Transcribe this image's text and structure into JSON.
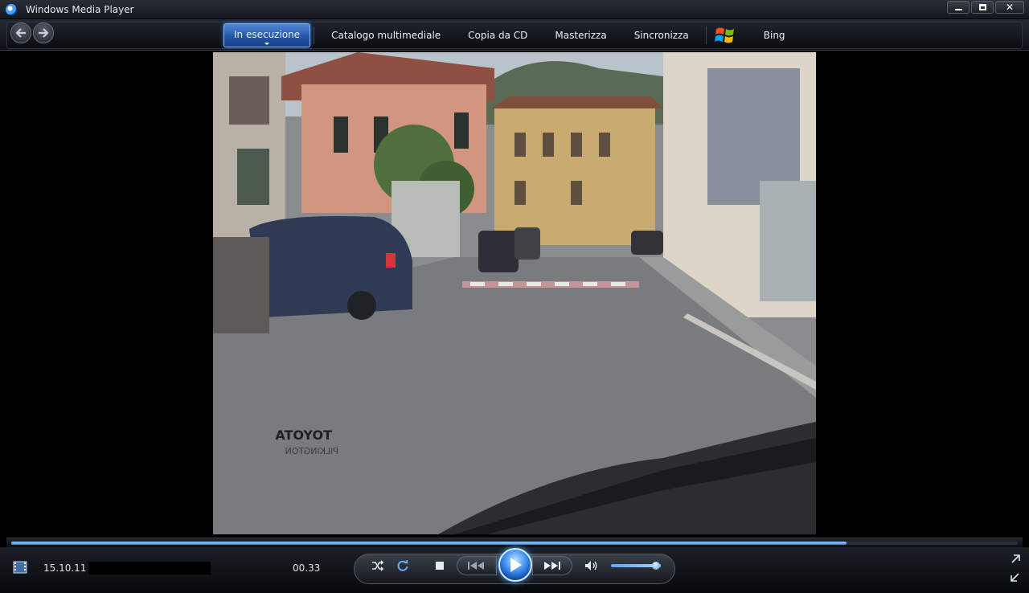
{
  "window": {
    "title": "Windows Media Player",
    "icon": "wmp-icon"
  },
  "window_controls": {
    "minimize_icon": "minimize-icon",
    "maximize_icon": "maximize-icon",
    "close_symbol": "✕"
  },
  "nav": {
    "back_icon": "back-arrow-icon",
    "forward_icon": "forward-arrow-icon",
    "tabs": [
      {
        "label": "In esecuzione",
        "active": true
      },
      {
        "label": "Catalogo multimediale",
        "active": false
      },
      {
        "label": "Copia da CD",
        "active": false
      },
      {
        "label": "Masterizza",
        "active": false
      },
      {
        "label": "Sincronizza",
        "active": false
      },
      {
        "label": "Bing",
        "active": false
      }
    ]
  },
  "video": {
    "overlay_text_1": "TOYOTA",
    "overlay_text_2": "PILKINGTON"
  },
  "playback": {
    "seek_progress": 0.83,
    "date": "15.10.11",
    "elapsed": "00.33",
    "volume": 0.9
  },
  "colors": {
    "accent": "#3d8ff0",
    "active_tab": "#2f6bd0",
    "background": "#000000"
  }
}
